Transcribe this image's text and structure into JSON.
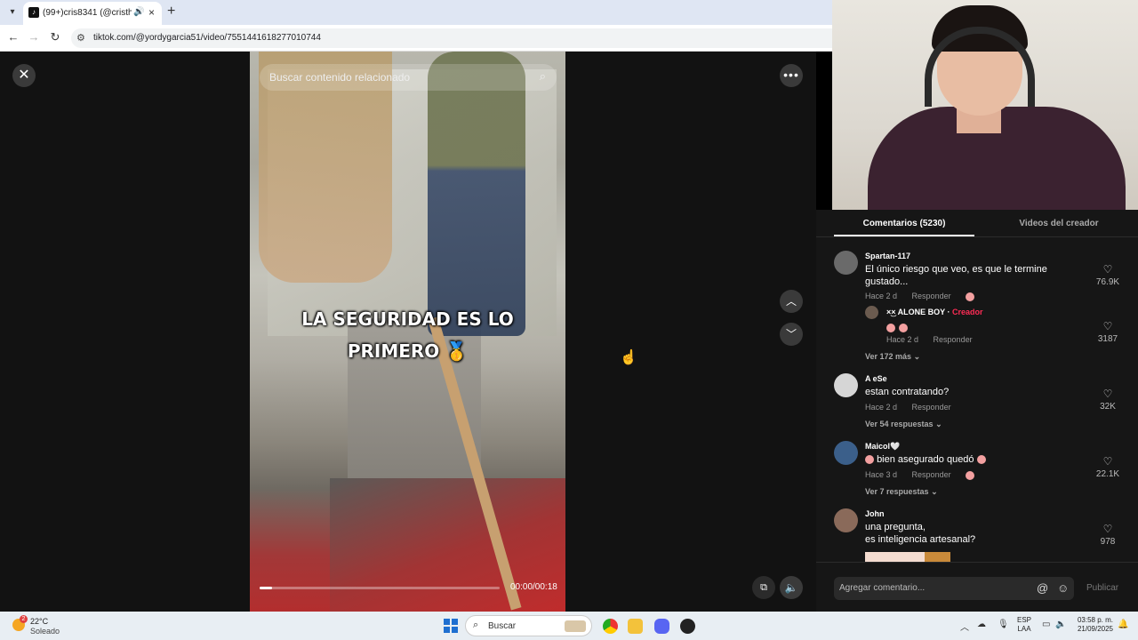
{
  "browser": {
    "tab_title": "(99+)cris8341 (@cristhian8...",
    "tab_audio_icon": "speaker-icon",
    "tab_close": "×",
    "new_tab": "+",
    "url": "tiktok.com/@yordygarcia51/video/7551441618277010744"
  },
  "video": {
    "search_placeholder": "Buscar contenido relacionado",
    "caption_line1": "LA SEGURIDAD ES LO",
    "caption_line2": "PRIMERO 🥇",
    "time": "00:00/00:18",
    "progress": 0.05
  },
  "comments_panel": {
    "tab_comments": "Comentarios (5230)",
    "tab_creator_videos": "Videos del creador",
    "reply_label": "Responder",
    "comments": [
      {
        "user": "Spartan-117",
        "text": "El único riesgo que veo, es que le termine gustado...",
        "time": "Hace 2 d",
        "likes": "76.9K",
        "reply": {
          "user": "×͜× ALONE    BOY",
          "badge": "Creador",
          "time": "Hace 2 d",
          "likes": "3187"
        },
        "more": "Ver 172 más"
      },
      {
        "user": "A eSe",
        "text": "estan contratando?",
        "time": "Hace 2 d",
        "likes": "32K",
        "more": "Ver 54 respuestas"
      },
      {
        "user": "Maicol🤍",
        "text": "bien asegurado quedó",
        "time": "Hace 3 d",
        "likes": "22.1K",
        "more": "Ver 7 respuestas"
      },
      {
        "user": "John",
        "text": "una pregunta,\nes inteligencia artesanal?",
        "likes": "978"
      }
    ],
    "input_placeholder": "Agregar comentario...",
    "publish": "Publicar"
  },
  "taskbar": {
    "temperature": "22°C",
    "weather": "Soleado",
    "weather_badge": "2",
    "search": "Buscar",
    "lang_line1": "ESP",
    "lang_line2": "LAA",
    "time": "03:58 p. m.",
    "date": "21/09/2025"
  }
}
